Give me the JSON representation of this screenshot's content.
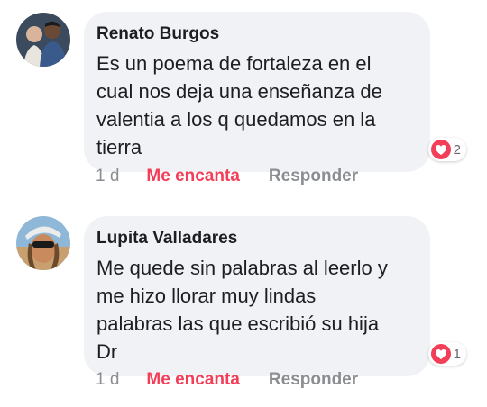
{
  "colors": {
    "bubble": "#f0f2f5",
    "heart": "#f33e58",
    "muted": "#8a8d91",
    "text": "#1c1e21"
  },
  "comments": [
    {
      "author": "Renato Burgos",
      "text": "Es un poema de fortaleza en el\ncual nos deja una enseñanza de\nvalentia a los q quedamos en la\ntierra",
      "reaction_icon": "heart-icon",
      "reaction_count": "2",
      "time": "1 d",
      "like_label": "Me encanta",
      "reply_label": "Responder"
    },
    {
      "author": "Lupita Valladares",
      "text": "Me quede sin palabras al leerlo y\nme hizo llorar muy lindas\npalabras las que escribió su hija\nDr",
      "reaction_icon": "heart-icon",
      "reaction_count": "1",
      "time": "1 d",
      "like_label": "Me encanta",
      "reply_label": "Responder"
    }
  ]
}
